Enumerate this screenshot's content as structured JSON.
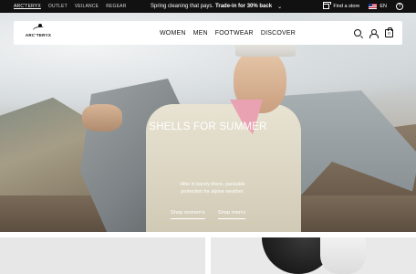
{
  "topbar": {
    "brand_links": [
      "ARC'TERYX",
      "OUTLET",
      "VEILANCE",
      "REGEAR"
    ],
    "promo_text": "Spring cleaning that pays.",
    "promo_bold": "Trade-in for 30% back",
    "find_store": "Find a store",
    "language": "EN",
    "help": "?"
  },
  "header": {
    "logo_text": "ARC'TERYX",
    "nav": [
      "WOMEN",
      "MEN",
      "FOOTWEAR",
      "DISCOVER"
    ],
    "cart_count": "0"
  },
  "hero": {
    "title": "SHELLS FOR SUMMER",
    "subtitle": "Hike in barely-there, packable protection for alpine weather.",
    "cta_women": "Shop women's",
    "cta_men": "Shop men's"
  },
  "colors": {
    "topbar_bg": "#111111",
    "nav_bg": "#ffffff",
    "hero_text": "#ffffff"
  }
}
